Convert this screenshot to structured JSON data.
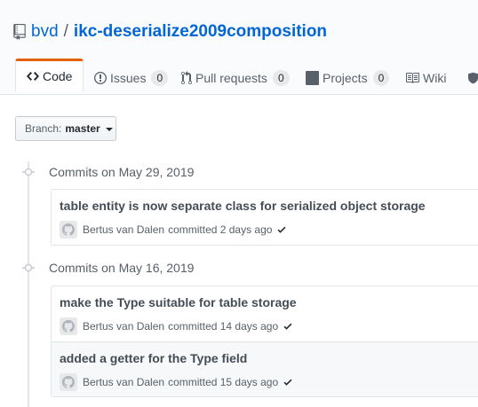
{
  "repo": {
    "icon": "repo-icon",
    "owner": "bvd",
    "separator": "/",
    "name": "ikc-deserialize2009composition"
  },
  "tabs": [
    {
      "label": "Code",
      "icon": "code-icon",
      "selected": true
    },
    {
      "label": "Issues",
      "icon": "issue-icon",
      "count": "0"
    },
    {
      "label": "Pull requests",
      "icon": "pull-request-icon",
      "count": "0"
    },
    {
      "label": "Projects",
      "icon": "project-icon",
      "count": "0"
    },
    {
      "label": "Wiki",
      "icon": "book-icon"
    },
    {
      "label": "",
      "icon": "shield-icon"
    }
  ],
  "branch": {
    "label": "Branch:",
    "value": "master"
  },
  "groups": [
    {
      "title": "Commits on May 29, 2019",
      "commits": [
        {
          "message": "table entity is now separate class for serialized object storage",
          "author": "Bertus van Dalen",
          "committed": "committed 2 days ago",
          "status": "check-icon"
        }
      ]
    },
    {
      "title": "Commits on May 16, 2019",
      "commits": [
        {
          "message": "make the Type suitable for table storage",
          "author": "Bertus van Dalen",
          "committed": "committed 14 days ago",
          "status": "check-icon"
        },
        {
          "message": "added a getter for the Type field",
          "author": "Bertus van Dalen",
          "committed": "committed 15 days ago",
          "status": "check-icon"
        }
      ]
    }
  ],
  "colors": {
    "link": "#0366d6",
    "tab_accent": "#e36209",
    "success": "#28a745"
  }
}
